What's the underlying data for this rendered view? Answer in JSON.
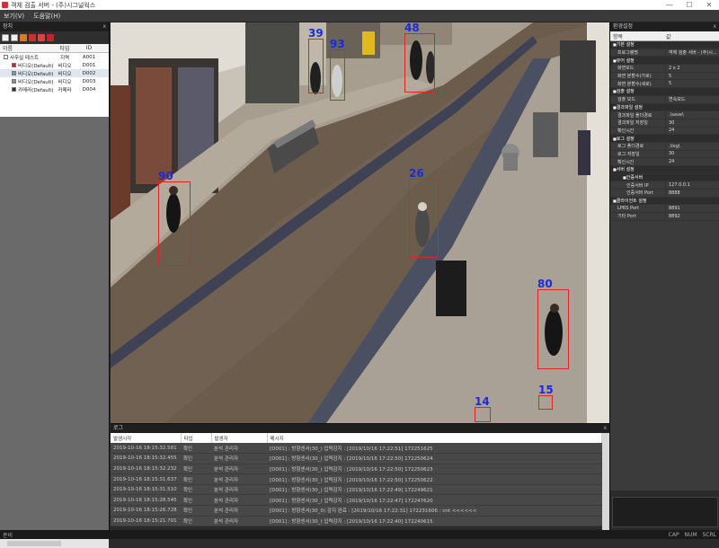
{
  "titlebar": {
    "title": "객체 검출 서버 - (주)시그널웍스",
    "minimize": "—",
    "maximize": "☐",
    "close": "✕"
  },
  "menu": {
    "items": [
      "보기(V)",
      "도움말(H)"
    ]
  },
  "left_panel": {
    "title": "장치",
    "close": "x",
    "columns": [
      "이름",
      "타입",
      "ID"
    ],
    "tree": [
      {
        "name": "사무실 테스트",
        "type": "지역",
        "id": "A001",
        "color": "#ffffff",
        "indent": 0
      },
      {
        "name": "비디오(Default)",
        "type": "비디오",
        "id": "D001",
        "color": "#d02020",
        "indent": 1
      },
      {
        "name": "비디오(Default)",
        "type": "비디오",
        "id": "D002",
        "color": "#909090",
        "indent": 1,
        "selected": true
      },
      {
        "name": "비디오(Default)",
        "type": "비디오",
        "id": "D003",
        "color": "#909090",
        "indent": 1
      },
      {
        "name": "카메라(Default)",
        "type": "카메라",
        "id": "D004",
        "color": "#303030",
        "indent": 1
      }
    ]
  },
  "detections": [
    {
      "id": "39"
    },
    {
      "id": "93"
    },
    {
      "id": "48"
    },
    {
      "id": "90"
    },
    {
      "id": "26"
    },
    {
      "id": "80"
    },
    {
      "id": "14"
    },
    {
      "id": "15"
    }
  ],
  "right_panel": {
    "title": "환경설정",
    "close": "x",
    "columns": [
      "항목",
      "값"
    ],
    "properties": [
      {
        "k": "기본 설정",
        "v": "",
        "t": "cat"
      },
      {
        "k": "프로그램명",
        "v": "객체 검출 서버 - (주)시...",
        "t": ""
      },
      {
        "k": "뷰어 설정",
        "v": "",
        "t": "cat"
      },
      {
        "k": "화면모드",
        "v": "2 x 2",
        "t": ""
      },
      {
        "k": "화면 분할수(가로)",
        "v": "5",
        "t": ""
      },
      {
        "k": "화면 분할수(세로)",
        "v": "5",
        "t": ""
      },
      {
        "k": "검출 설정",
        "v": "",
        "t": "cat"
      },
      {
        "k": "검출 모드",
        "v": "연속모드",
        "t": ""
      },
      {
        "k": "결과파일 설정",
        "v": "",
        "t": "cat"
      },
      {
        "k": "결과파일 폴더경로",
        "v": ".\\save\\",
        "t": ""
      },
      {
        "k": "결과파일 저장일",
        "v": "30",
        "t": ""
      },
      {
        "k": "확인시간",
        "v": "24",
        "t": ""
      },
      {
        "k": "로그 설정",
        "v": "",
        "t": "cat"
      },
      {
        "k": "로그 폴더경로",
        "v": ".\\log\\",
        "t": ""
      },
      {
        "k": "로그 저장일",
        "v": "30",
        "t": ""
      },
      {
        "k": "확인시간",
        "v": "24",
        "t": ""
      },
      {
        "k": "서버 설정",
        "v": "",
        "t": "cat"
      },
      {
        "k": "인증서버",
        "v": "",
        "t": "cat sub"
      },
      {
        "k": "인증서버 IP",
        "v": "127.0.0.1",
        "t": "sub2"
      },
      {
        "k": "인증서버 Port",
        "v": "8888",
        "t": "sub2"
      },
      {
        "k": "클라이언트 설정",
        "v": "",
        "t": "cat"
      },
      {
        "k": "LPRS Port",
        "v": "8891",
        "t": ""
      },
      {
        "k": "기타 Port",
        "v": "8892",
        "t": ""
      }
    ]
  },
  "log": {
    "title": "로그",
    "close": "x",
    "columns": [
      "발생시각",
      "타입",
      "발생자",
      "메시지"
    ],
    "rows": [
      [
        "2019-10-16 18:15:32.581",
        "확인",
        "분석 관리자",
        "[D001] : 방향센서(30_) 입력감지 : [2019/10/16 17:22:51] 172251625"
      ],
      [
        "2019-10-16 18:15:32.455",
        "확인",
        "분석 관리자",
        "[D001] : 방향센서(30_) 입력감지 : [2019/10/16 17:22:50] 172250624"
      ],
      [
        "2019-10-16 18:15:32.232",
        "확인",
        "분석 관리자",
        "[D001] : 방향센서(30_) 입력감지 : [2019/10/16 17:22:50] 172250623"
      ],
      [
        "2019-10-16 18:15:31.637",
        "확인",
        "분석 관리자",
        "[D001] : 방향센서(30_) 입력감지 : [2019/10/16 17:22:50] 172250622"
      ],
      [
        "2019-10-16 18:15:31.510",
        "확인",
        "분석 관리자",
        "[D001] : 방향센서(30_) 입력감지 : [2019/10/16 17:22:49] 172249621"
      ],
      [
        "2019-10-16 18:15:28.545",
        "확인",
        "분석 관리자",
        "[D001] : 방향센서(30_) 입력감지 : [2019/10/16 17:22:47] 172247620"
      ],
      [
        "2019-10-16 18:15:26.728",
        "확인",
        "분석 관리자",
        "[D001] : 방향센서(30_0) 감지 완료 : [2019/10/16 17:22:31] 172231606 : cnt <<<<<<"
      ],
      [
        "2019-10-16 18:15:21.701",
        "확인",
        "분석 관리자",
        "[D001] : 방향센서(30_) 입력감지 : [2019/10/16 17:22:40] 172240615"
      ]
    ]
  },
  "statusbar": {
    "left": "준비",
    "indicators": [
      "CAP",
      "NUM",
      "SCRL"
    ]
  },
  "colors": {
    "detection_box": "#e02424",
    "detection_id": "#1c2bd6"
  }
}
